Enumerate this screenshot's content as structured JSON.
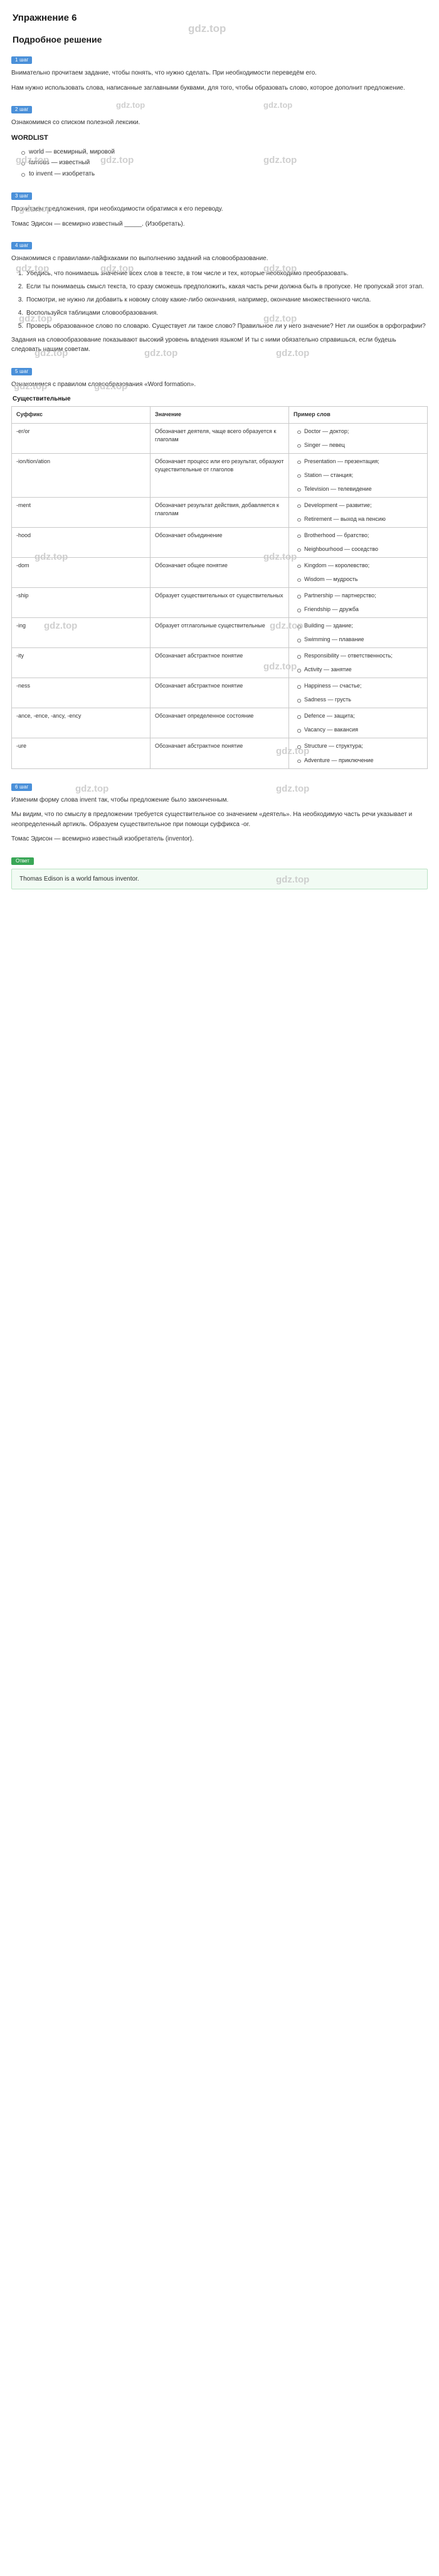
{
  "exercise": {
    "title": "Упражнение 6"
  },
  "solution": {
    "title": "Подробное решение"
  },
  "watermark": {
    "text": "gdz.top"
  },
  "steps": [
    {
      "label": "1 шаг",
      "paragraphs": [
        "Внимательно прочитаем задание, чтобы понять, что нужно сделать. При необходимости переведём его.",
        "Нам нужно использовать слова, написанные заглавными буквами, для того, чтобы образовать слово, которое дополнит предложение."
      ]
    },
    {
      "label": "2 шаг",
      "paragraphs": [
        "Ознакомимся со списком полезной лексики."
      ],
      "wordlist_title": "WORDLIST",
      "wordlist": [
        "world — всемирный, мировой",
        "famous — известный",
        "to invent — изобретать"
      ]
    },
    {
      "label": "3 шаг",
      "paragraphs": [
        "Прочитаем предложения, при необходимости обратимся к его переводу.",
        "Томас Эдисон — всемирно известный _____. (Изобретать)."
      ]
    },
    {
      "label": "4 шаг",
      "paragraphs": [
        "Ознакомимся с правилами-лайфхаками по выполнению заданий на словообразование."
      ],
      "tips": [
        "Убедись, что понимаешь значение всех слов в тексте, в том числе и тех, которые необходимо преобразовать.",
        "Если ты понимаешь смысл текста, то сразу сможешь предположить, какая часть речи должна быть в пропуске. Не пропускай этот этап.",
        "Посмотри, не нужно ли добавить к новому слову какие-либо окончания, например, окончание множественного числа.",
        "Воспользуйся таблицами словообразования.",
        "Проверь образованное слово по словарю. Существует ли такое слово? Правильное ли у него значение? Нет ли ошибок в орфографии?"
      ],
      "closing": "Задания на словообразование показывают высокий уровень владения языком! И ты с ними обязательно справишься, если будешь следовать нашим советам."
    },
    {
      "label": "5 шаг",
      "paragraphs": [
        "Ознакомимся с правилом словообразования «Word formation»."
      ],
      "table_caption": "Существительные",
      "table": {
        "headers": [
          "Суффикс",
          "Значение",
          "Пример слов"
        ],
        "rows": [
          {
            "suffix": "-er/or",
            "meaning": "Обозначает деятеля, чаще всего образуется к глаголам",
            "examples": [
              "Doctor — доктор;",
              "Singer — певец"
            ]
          },
          {
            "suffix": "-ion/tion/ation",
            "meaning": "Обозначает процесс или его результат, образуют существительные от глаголов",
            "examples": [
              "Presentation — презентация;",
              "Station — станция;",
              "Television — телевидение"
            ]
          },
          {
            "suffix": "-ment",
            "meaning": "Обозначает результат действия, добавляется к глаголам",
            "examples": [
              "Development — развитие;",
              "Retirement — выход на пенсию"
            ]
          },
          {
            "suffix": "-hood",
            "meaning": "Обозначает объединение",
            "examples": [
              "Brotherhood — братство;",
              "Neighbourhood — соседство"
            ]
          },
          {
            "suffix": "-dom",
            "meaning": "Обозначает общее понятие",
            "examples": [
              "Kingdom — королевство;",
              "Wisdom — мудрость"
            ]
          },
          {
            "suffix": "-ship",
            "meaning": "Образует существительных от существительных",
            "examples": [
              "Partnership — партнерство;",
              "Friendship — дружба"
            ]
          },
          {
            "suffix": "-ing",
            "meaning": "Образует отглагольные существительные",
            "examples": [
              "Building — здание;",
              "Swimming — плавание"
            ]
          },
          {
            "suffix": "-ity",
            "meaning": "Обозначает абстрактное понятие",
            "examples": [
              "Responsibility — ответственность;",
              "Activity — занятие"
            ]
          },
          {
            "suffix": "-ness",
            "meaning": "Обозначает абстрактное понятие",
            "examples": [
              "Happiness — счастье;",
              "Sadness — грусть"
            ]
          },
          {
            "suffix": "-ance, -ence, -ancy, -ency",
            "meaning": "Обозначает определенное состояние",
            "examples": [
              "Defence — защита;",
              "Vacancy — вакансия"
            ]
          },
          {
            "suffix": "-ure",
            "meaning": "Обозначает абстрактное понятие",
            "examples": [
              "Structure — структура;",
              "Adventure — приключение"
            ]
          }
        ]
      }
    },
    {
      "label": "6 шаг",
      "paragraphs": [
        "Изменим форму слова invent так, чтобы предложение было законченным.",
        "Мы видим, что по смыслу в предложении требуется существительное со значением «деятель». На необходимую часть речи указывает и неопределенный артикль. Образуем существительное при помощи суффикса -or.",
        "Томас Эдисон — всемирно известный изобретатель (inventor)."
      ]
    }
  ],
  "answer": {
    "badge": "Ответ",
    "text": "Thomas Edison is a world famous inventor."
  }
}
